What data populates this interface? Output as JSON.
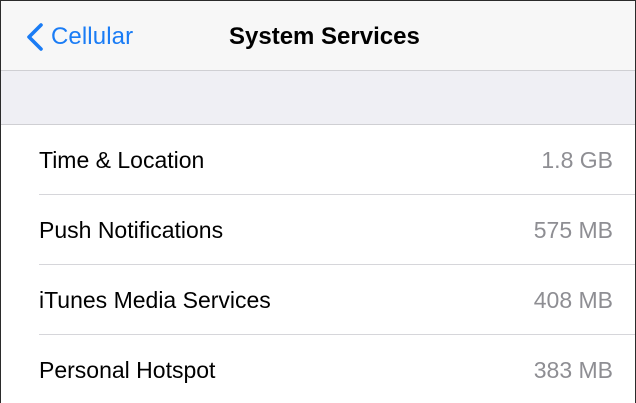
{
  "nav": {
    "back_label": "Cellular",
    "title": "System Services"
  },
  "services": [
    {
      "label": "Time & Location",
      "value": "1.8 GB"
    },
    {
      "label": "Push Notifications",
      "value": "575 MB"
    },
    {
      "label": "iTunes Media Services",
      "value": "408 MB"
    },
    {
      "label": "Personal Hotspot",
      "value": "383 MB"
    }
  ],
  "colors": {
    "accent": "#1a7cf5",
    "secondary_text": "#8e8e93",
    "grouped_background": "#efeff4"
  },
  "icons": {
    "back": "chevron-left-icon"
  }
}
